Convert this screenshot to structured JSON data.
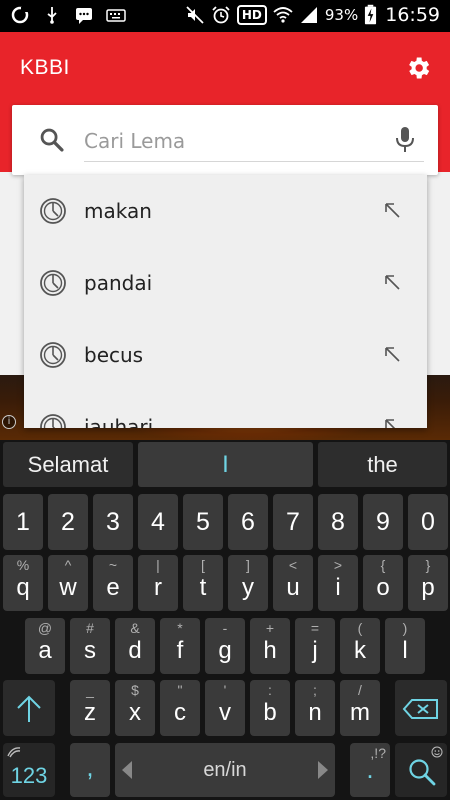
{
  "status_bar": {
    "battery": "93%",
    "time": "16:59",
    "hd": "HD"
  },
  "app": {
    "title": "KBBI"
  },
  "search": {
    "placeholder": "Cari Lema"
  },
  "suggestions": [
    "makan",
    "pandai",
    "becus",
    "jauhari"
  ],
  "keyboard": {
    "predictions": [
      "Selamat",
      "I",
      "the"
    ],
    "number_row": [
      "1",
      "2",
      "3",
      "4",
      "5",
      "6",
      "7",
      "8",
      "9",
      "0"
    ],
    "row1": [
      {
        "main": "q",
        "sub": "%"
      },
      {
        "main": "w",
        "sub": "^"
      },
      {
        "main": "e",
        "sub": "~"
      },
      {
        "main": "r",
        "sub": "|"
      },
      {
        "main": "t",
        "sub": "["
      },
      {
        "main": "y",
        "sub": "]"
      },
      {
        "main": "u",
        "sub": "<"
      },
      {
        "main": "i",
        "sub": ">"
      },
      {
        "main": "o",
        "sub": "{"
      },
      {
        "main": "p",
        "sub": "}"
      }
    ],
    "row2": [
      {
        "main": "a",
        "sub": "@"
      },
      {
        "main": "s",
        "sub": "#"
      },
      {
        "main": "d",
        "sub": "&"
      },
      {
        "main": "f",
        "sub": "*"
      },
      {
        "main": "g",
        "sub": "-"
      },
      {
        "main": "h",
        "sub": "+"
      },
      {
        "main": "j",
        "sub": "="
      },
      {
        "main": "k",
        "sub": "("
      },
      {
        "main": "l",
        "sub": ")"
      }
    ],
    "row3": [
      {
        "main": "z",
        "sub": "_"
      },
      {
        "main": "x",
        "sub": "$"
      },
      {
        "main": "c",
        "sub": "\""
      },
      {
        "main": "v",
        "sub": "'"
      },
      {
        "main": "b",
        "sub": ":"
      },
      {
        "main": "n",
        "sub": ";"
      },
      {
        "main": "m",
        "sub": "/"
      }
    ],
    "symbols_key": "123",
    "comma_key": ",",
    "space_label": "en/in",
    "period_key": ".",
    "period_sub": ",!?"
  }
}
